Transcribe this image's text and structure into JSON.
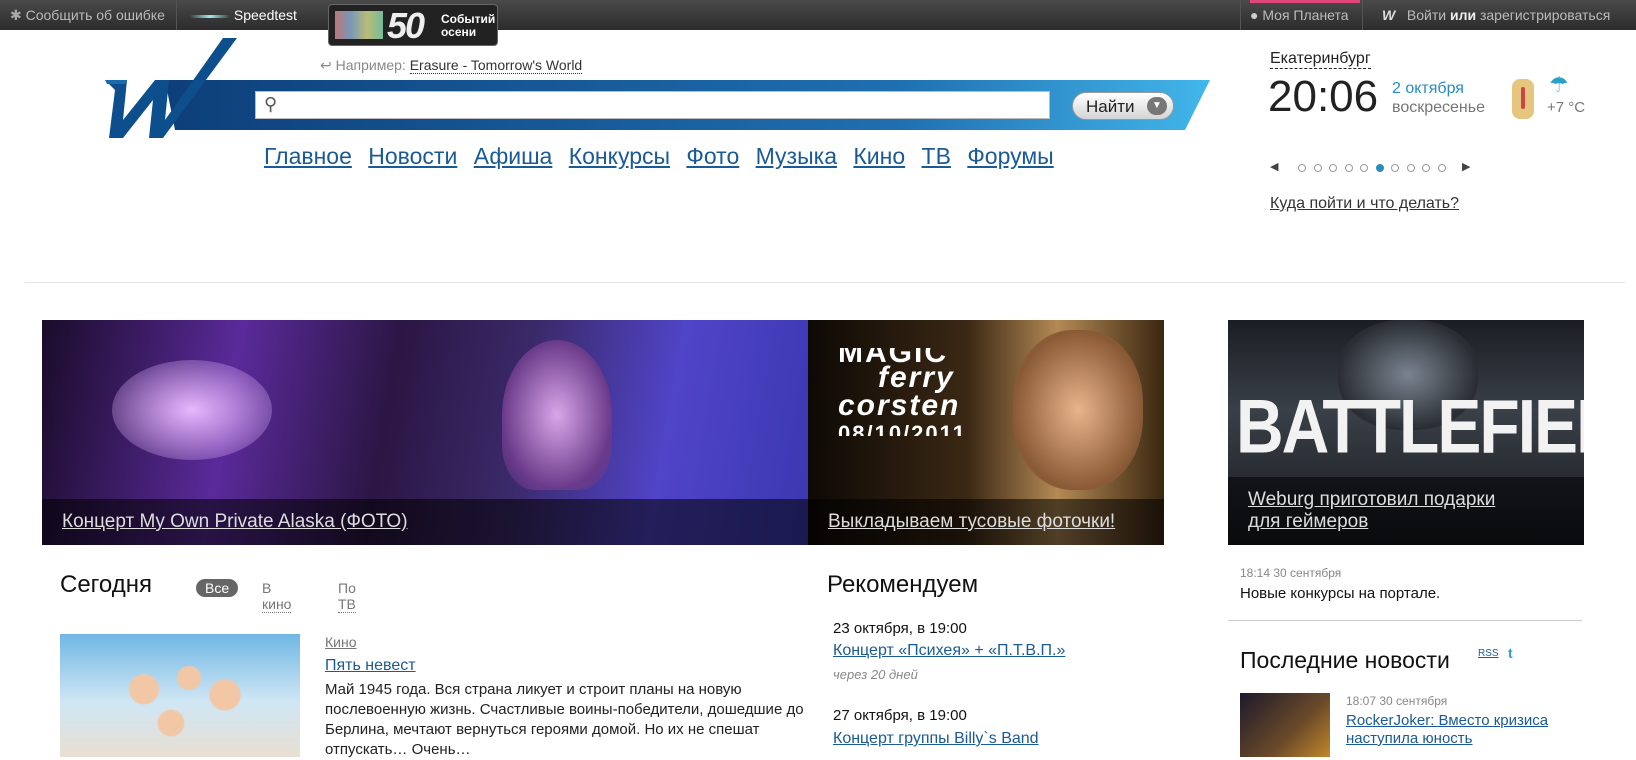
{
  "topbar": {
    "report_bug": "Сообщить об ошибке",
    "speedtest": "Speedtest",
    "promo_number": "50",
    "promo_text1": "Событий",
    "promo_text2": "осени",
    "my_planet": "Моя Планета",
    "login": "Войти",
    "or": "или",
    "register": "зарегистрироваться"
  },
  "search": {
    "example_label": "Например:",
    "example_value": "Erasure - Tomorrow's World",
    "button_label": "Найти",
    "input_value": ""
  },
  "nav": [
    "Главное",
    "Новости",
    "Афиша",
    "Конкурсы",
    "Фото",
    "Музыка",
    "Кино",
    "ТВ",
    "Форумы"
  ],
  "widget": {
    "city": "Екатеринбург",
    "time": "20:06",
    "date": "2 октября",
    "weekday": "воскресенье",
    "temperature": "+7 °C",
    "where_to_go": "Куда пойти и что делать?",
    "carousel_total": 10,
    "carousel_active": 5
  },
  "banners": [
    {
      "caption": "Концерт My Own Private Alaska (ФОТО)"
    },
    {
      "caption": "Выкладываем тусовые фоточки!",
      "poster_line1": "MAGIC",
      "poster_line2": "ferry",
      "poster_line3": "corsten",
      "poster_date": "08/10/2011"
    },
    {
      "caption": "Weburg приготовил подарки для геймеров",
      "poster_title": "BATTLEFIELD"
    }
  ],
  "today": {
    "title": "Сегодня",
    "tabs": [
      "Все",
      "В кино",
      "По ТВ"
    ],
    "category": "Кино",
    "movie_title": "Пять невест",
    "description": "Май 1945 года. Вся страна ликует и строит планы на новую послевоенную жизнь. Счастливые воины-победители, дошедшие до Берлина, мечтают вернуться героями домой. Но их не спешат отпускать… Очень…"
  },
  "recommend": {
    "title": "Рекомендуем",
    "events": [
      {
        "date": "23 октября, в 19:00",
        "title": "Концерт «Психея» + «П.Т.В.П.»",
        "relative": "через 20 дней"
      },
      {
        "date": "27 октября, в 19:00",
        "title": "Концерт группы Billy`s Band"
      }
    ]
  },
  "right": {
    "news_meta": "18:14 30 сентября",
    "news_text": "Новые конкурсы на портале.",
    "last_news_title": "Последние новости",
    "rss": "RSS",
    "news2_meta": "18:07 30 сентября",
    "news2_title": "RockerJoker: Вместо кризиса наступила юность"
  },
  "colors": {
    "link": "#1a5a96",
    "accent_blue": "#2a8cc0",
    "brand_dark": "#0d3f7a"
  }
}
